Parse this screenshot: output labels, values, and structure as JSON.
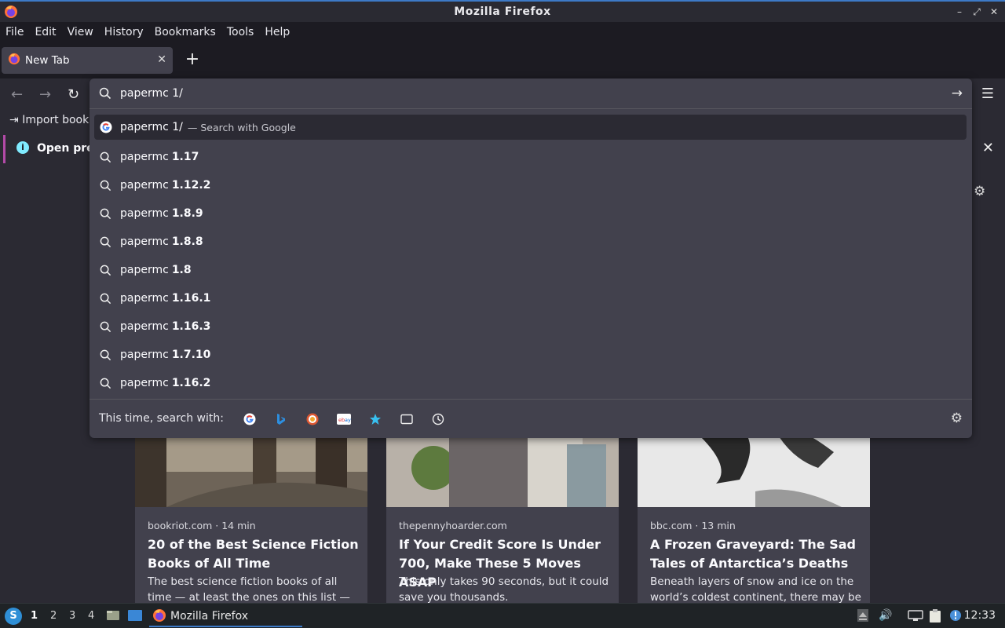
{
  "window": {
    "title": "Mozilla Firefox"
  },
  "menubar": {
    "items": [
      "File",
      "Edit",
      "View",
      "History",
      "Bookmarks",
      "Tools",
      "Help"
    ]
  },
  "tab": {
    "label": "New Tab"
  },
  "bookmarks": {
    "import_label": "Import book"
  },
  "notice": {
    "text": "Open pre"
  },
  "urlbar": {
    "value": "papermc 1/",
    "selected": {
      "term": "papermc 1/",
      "action": "— Search with Google"
    },
    "suggestions": [
      {
        "prefix": "papermc",
        "bold": "1.17"
      },
      {
        "prefix": "papermc",
        "bold": "1.12.2"
      },
      {
        "prefix": "papermc",
        "bold": "1.8.9"
      },
      {
        "prefix": "papermc",
        "bold": "1.8.8"
      },
      {
        "prefix": "papermc",
        "bold": "1.8"
      },
      {
        "prefix": "papermc",
        "bold": "1.16.1"
      },
      {
        "prefix": "papermc",
        "bold": "1.16.3"
      },
      {
        "prefix": "papermc",
        "bold": "1.7.10"
      },
      {
        "prefix": "papermc",
        "bold": "1.16.2"
      }
    ],
    "oneoff_label": "This time, search with:",
    "engines": [
      "google-icon",
      "bing-icon",
      "duckduckgo-icon",
      "ebay-icon",
      "bookmarks-star-icon",
      "tabs-icon",
      "history-icon"
    ]
  },
  "cards": [
    {
      "source": "bookriot.com · 14 min",
      "headline": "20 of the Best Science Fiction Books of All Time",
      "excerpt": "The best science fiction books of all time — at least the ones on this list — are the"
    },
    {
      "source": "thepennyhoarder.com",
      "headline": "If Your Credit Score Is Under 700, Make These 5 Moves ASAP",
      "excerpt": "This only takes 90 seconds, but it could save you thousands."
    },
    {
      "source": "bbc.com · 13 min",
      "headline": "A Frozen Graveyard: The Sad Tales of Antarctica’s Deaths",
      "excerpt": "Beneath layers of snow and ice on the world’s coldest continent, there may be"
    }
  ],
  "taskbar": {
    "workspaces": [
      "1",
      "2",
      "3",
      "4"
    ],
    "app_label": "Mozilla Firefox",
    "clock": "12:33"
  },
  "colors": {
    "accent": "#3d7ac7",
    "panel": "#42414d",
    "background": "#2b2a33"
  }
}
